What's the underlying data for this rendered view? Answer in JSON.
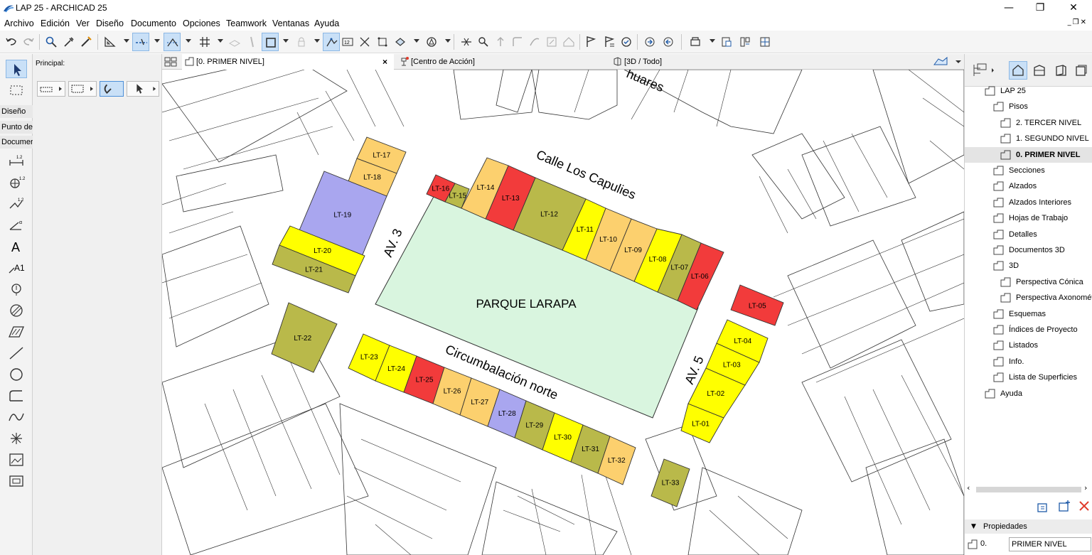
{
  "window": {
    "title": "LAP 25 - ARCHICAD 25",
    "minimize_glyph": "—",
    "maximize_glyph": "❐",
    "close_glyph": "✕"
  },
  "menu": [
    "Archivo",
    "Edición",
    "Ver",
    "Diseño",
    "Documento",
    "Opciones",
    "Teamwork",
    "Ventanas",
    "Ayuda"
  ],
  "toolbox": {
    "categories": [
      "Diseño",
      "Punto de",
      "Documer"
    ]
  },
  "infobox": {
    "label": "Principal:"
  },
  "tabs": [
    {
      "label": "[0. PRIMER NIVEL]",
      "active": true,
      "icon": "floor-plan-icon"
    },
    {
      "label": "[Centro de Acción]",
      "active": false,
      "icon": "action-center-icon"
    },
    {
      "label": "[3D / Todo]",
      "active": false,
      "icon": "3d-window-icon"
    }
  ],
  "tab_close_glyph": "×",
  "plan": {
    "park_label": "PARQUE LARAPA",
    "streets": {
      "top": "Calle Los Capulies",
      "bottom": "Circumbalación norte",
      "left": "AV. 3",
      "right": "AV. 5",
      "partial_top": "huares"
    },
    "legend_colors": {
      "red": "#f23b3b",
      "olive": "#b9b94a",
      "orange": "#fcd06e",
      "yellow": "#ffff00",
      "blue": "#a9a6ef",
      "park": "#d9f5df"
    },
    "lots": [
      {
        "id": "LT-01",
        "color": "yellow"
      },
      {
        "id": "LT-02",
        "color": "yellow"
      },
      {
        "id": "LT-03",
        "color": "yellow"
      },
      {
        "id": "LT-04",
        "color": "yellow"
      },
      {
        "id": "LT-05",
        "color": "red"
      },
      {
        "id": "LT-06",
        "color": "red"
      },
      {
        "id": "LT-07",
        "color": "olive"
      },
      {
        "id": "LT-08",
        "color": "yellow"
      },
      {
        "id": "LT-09",
        "color": "orange"
      },
      {
        "id": "LT-10",
        "color": "orange"
      },
      {
        "id": "LT-11",
        "color": "yellow"
      },
      {
        "id": "LT-12",
        "color": "olive"
      },
      {
        "id": "LT-13",
        "color": "red"
      },
      {
        "id": "LT-14",
        "color": "orange"
      },
      {
        "id": "LT-15",
        "color": "olive"
      },
      {
        "id": "LT-16",
        "color": "red"
      },
      {
        "id": "LT-17",
        "color": "orange"
      },
      {
        "id": "LT-18",
        "color": "orange"
      },
      {
        "id": "LT-19",
        "color": "blue"
      },
      {
        "id": "LT-20",
        "color": "yellow"
      },
      {
        "id": "LT-21",
        "color": "olive"
      },
      {
        "id": "LT-22",
        "color": "olive"
      },
      {
        "id": "LT-23",
        "color": "yellow"
      },
      {
        "id": "LT-24",
        "color": "yellow"
      },
      {
        "id": "LT-25",
        "color": "red"
      },
      {
        "id": "LT-26",
        "color": "orange"
      },
      {
        "id": "LT-27",
        "color": "orange"
      },
      {
        "id": "LT-28",
        "color": "blue"
      },
      {
        "id": "LT-29",
        "color": "olive"
      },
      {
        "id": "LT-30",
        "color": "yellow"
      },
      {
        "id": "LT-31",
        "color": "olive"
      },
      {
        "id": "LT-32",
        "color": "orange"
      },
      {
        "id": "LT-33",
        "color": "olive"
      }
    ]
  },
  "navigator": {
    "items": [
      {
        "label": "LAP 25",
        "icon": "project-icon",
        "arrow": "∨"
      },
      {
        "label": "Pisos",
        "icon": "folder-icon",
        "arrow": "∨"
      },
      {
        "label": "2. TERCER NIVEL",
        "icon": "story-icon",
        "arrow": ""
      },
      {
        "label": "1. SEGUNDO NIVEL",
        "icon": "story-icon",
        "arrow": ""
      },
      {
        "label": "0. PRIMER NIVEL",
        "icon": "story-icon",
        "arrow": ""
      },
      {
        "label": "Secciones",
        "icon": "section-icon",
        "arrow": ""
      },
      {
        "label": "Alzados",
        "icon": "elevation-icon",
        "arrow": ""
      },
      {
        "label": "Alzados Interiores",
        "icon": "interior-elevation-icon",
        "arrow": ""
      },
      {
        "label": "Hojas de Trabajo",
        "icon": "worksheet-icon",
        "arrow": ""
      },
      {
        "label": "Detalles",
        "icon": "detail-icon",
        "arrow": ""
      },
      {
        "label": "Documentos 3D",
        "icon": "3d-document-icon",
        "arrow": ""
      },
      {
        "label": "3D",
        "icon": "3d-icon",
        "arrow": "∨"
      },
      {
        "label": "Perspectiva Cónica",
        "icon": "perspective-icon",
        "arrow": ""
      },
      {
        "label": "Perspectiva Axonométrica",
        "icon": "axonometry-icon",
        "arrow": ""
      },
      {
        "label": "Esquemas",
        "icon": "schedule-icon",
        "arrow": ">"
      },
      {
        "label": "Índices de Proyecto",
        "icon": "index-icon",
        "arrow": ">"
      },
      {
        "label": "Listados",
        "icon": "list-icon",
        "arrow": ">"
      },
      {
        "label": "Info.",
        "icon": "info-icon",
        "arrow": ">"
      },
      {
        "label": "Lista de Superficies",
        "icon": "area-list-icon",
        "arrow": ""
      },
      {
        "label": "Ayuda",
        "icon": "help-icon",
        "arrow": ">"
      }
    ],
    "selected": "0. PRIMER NIVEL"
  },
  "properties": {
    "header": "Propiedades",
    "id_value": "0.",
    "name_value": "PRIMER NIVEL"
  }
}
